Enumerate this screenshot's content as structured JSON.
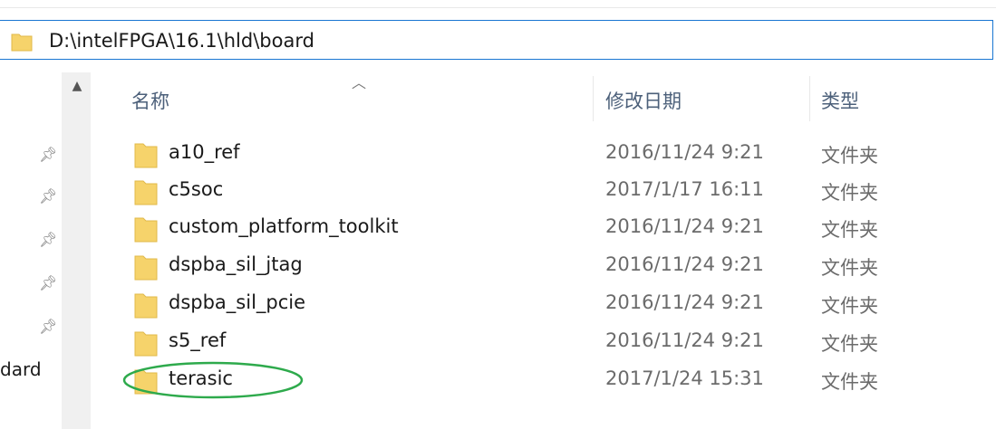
{
  "address": {
    "path": "D:\\intelFPGA\\16.1\\hld\\board"
  },
  "nav": {
    "clipped_label": "dard",
    "pin_icon": "pin-icon",
    "scroll_up_icon": "chevron-up-icon"
  },
  "columns": {
    "name": "名称",
    "date_modified": "修改日期",
    "type": "类型",
    "sort_icon": "chevron-up-icon"
  },
  "rows": [
    {
      "name": "a10_ref",
      "date": "2016/11/24 9:21",
      "type": "文件夹"
    },
    {
      "name": "c5soc",
      "date": "2017/1/17 16:11",
      "type": "文件夹"
    },
    {
      "name": "custom_platform_toolkit",
      "date": "2016/11/24 9:21",
      "type": "文件夹"
    },
    {
      "name": "dspba_sil_jtag",
      "date": "2016/11/24 9:21",
      "type": "文件夹"
    },
    {
      "name": "dspba_sil_pcie",
      "date": "2016/11/24 9:21",
      "type": "文件夹"
    },
    {
      "name": "s5_ref",
      "date": "2016/11/24 9:21",
      "type": "文件夹"
    },
    {
      "name": "terasic",
      "date": "2017/1/24 15:31",
      "type": "文件夹"
    }
  ],
  "colors": {
    "accent": "#1976d2",
    "folder": "#f6d36b",
    "annotation": "#2eaa4c"
  }
}
